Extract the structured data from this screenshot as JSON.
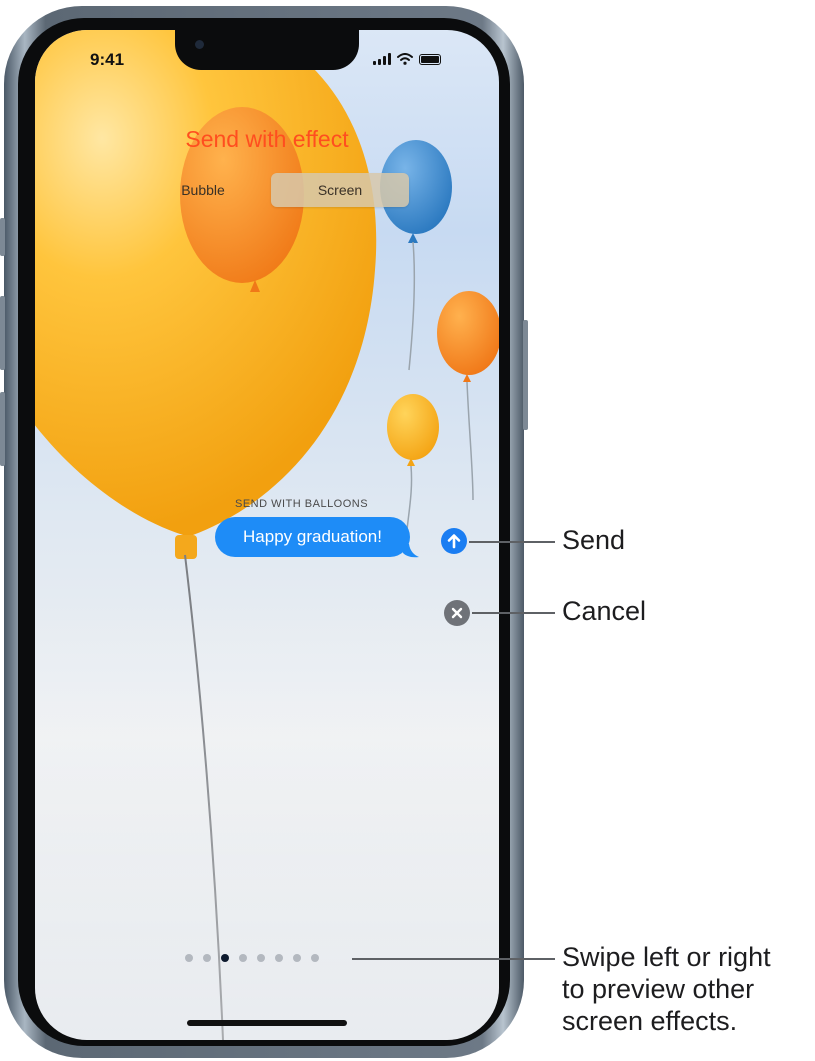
{
  "status_bar": {
    "time": "9:41"
  },
  "effect_picker": {
    "title": "Send with effect",
    "tabs": [
      "Bubble",
      "Screen"
    ],
    "selected_tab": "Screen"
  },
  "message": {
    "effect_caption": "SEND WITH BALLOONS",
    "text": "Happy graduation!"
  },
  "pager": {
    "count": 8,
    "active_index": 2
  },
  "callouts": {
    "send": "Send",
    "cancel": "Cancel",
    "swipe": [
      "Swipe left or right",
      "to preview other",
      "screen effects."
    ]
  },
  "icons": {
    "send": "arrow-up-icon",
    "cancel": "xmark-icon",
    "signal": "cellular-signal-icon",
    "wifi": "wifi-icon",
    "battery": "battery-icon"
  },
  "colors": {
    "effect_title": "#ff4e1f",
    "message_bubble": "#1e8cf7",
    "send_button": "#1a7df2",
    "cancel_button": "#6f7278",
    "active_dot": "#0e1a2e",
    "inactive_dot": "#b3b8bf"
  }
}
